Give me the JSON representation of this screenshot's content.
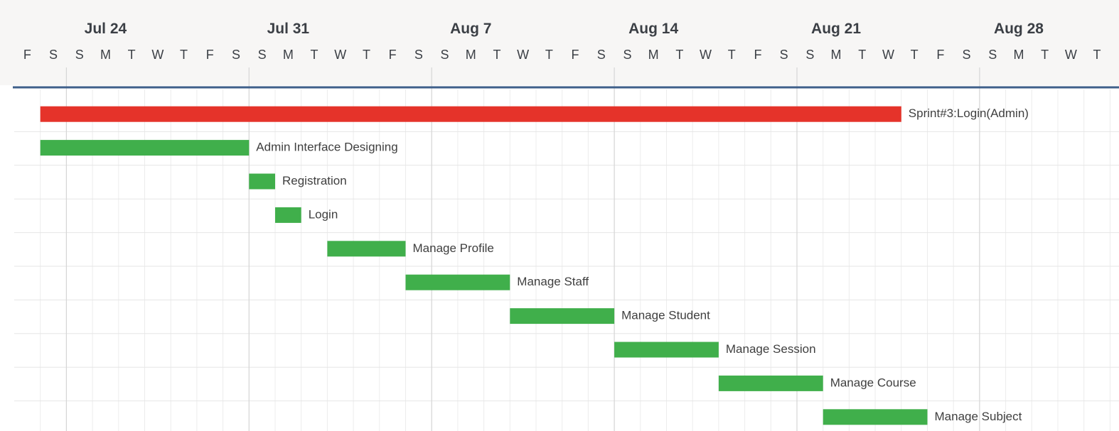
{
  "chart_data": {
    "type": "gantt",
    "timeline": {
      "start_date": "2023-07-21",
      "end_date": "2023-08-31",
      "week_labels": [
        {
          "date": "2023-07-24",
          "label": "Jul 24"
        },
        {
          "date": "2023-07-31",
          "label": "Jul 31"
        },
        {
          "date": "2023-08-07",
          "label": "Aug 7"
        },
        {
          "date": "2023-08-14",
          "label": "Aug 14"
        },
        {
          "date": "2023-08-21",
          "label": "Aug 21"
        },
        {
          "date": "2023-08-28",
          "label": "Aug 28"
        }
      ],
      "weekday_letters": [
        "S",
        "M",
        "T",
        "W",
        "T",
        "F",
        "S"
      ]
    },
    "tasks": [
      {
        "name": "Sprint#3:Login(Admin)",
        "start": "2023-07-22",
        "end": "2023-08-24",
        "color": "#e5332a"
      },
      {
        "name": "Admin Interface Designing",
        "start": "2023-07-22",
        "end": "2023-07-30",
        "color": "#40af4b"
      },
      {
        "name": "Registration",
        "start": "2023-07-30",
        "end": "2023-07-31",
        "color": "#40af4b"
      },
      {
        "name": "Login",
        "start": "2023-07-31",
        "end": "2023-08-01",
        "color": "#40af4b"
      },
      {
        "name": "Manage Profile",
        "start": "2023-08-02",
        "end": "2023-08-05",
        "color": "#40af4b"
      },
      {
        "name": "Manage Staff",
        "start": "2023-08-05",
        "end": "2023-08-09",
        "color": "#40af4b"
      },
      {
        "name": "Manage Student",
        "start": "2023-08-09",
        "end": "2023-08-13",
        "color": "#40af4b"
      },
      {
        "name": "Manage Session",
        "start": "2023-08-13",
        "end": "2023-08-17",
        "color": "#40af4b"
      },
      {
        "name": "Manage Course",
        "start": "2023-08-17",
        "end": "2023-08-21",
        "color": "#40af4b"
      },
      {
        "name": "Manage Subject",
        "start": "2023-08-21",
        "end": "2023-08-25",
        "color": "#40af4b"
      }
    ]
  },
  "colors": {
    "header_background": "#f7f6f5",
    "header_divider": "#3f5f8a",
    "grid_day": "#ececec",
    "grid_week": "#d6d6d6",
    "row_line": "#e6e6e6",
    "text": "#3b3f45"
  }
}
